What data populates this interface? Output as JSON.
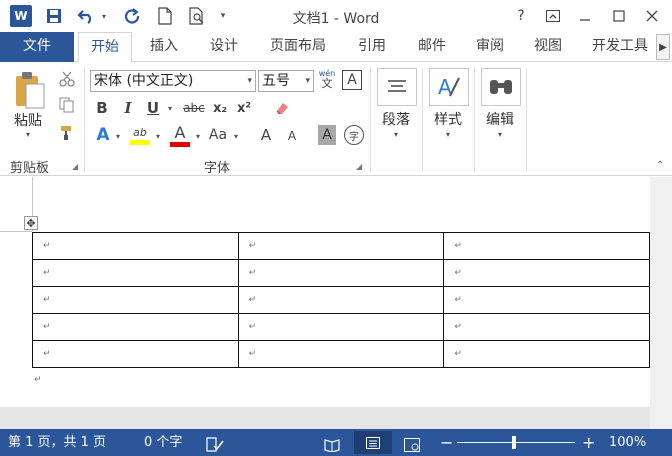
{
  "app": {
    "logo_letter": "W",
    "title": "文档1 - Word"
  },
  "quick_access": {
    "save_icon": "save-icon",
    "undo_icon": "undo-icon",
    "redo_icon": "repeat-icon",
    "new_icon": "new-document-icon",
    "preview_icon": "print-preview-icon",
    "customize_icon": "customize-quick-access-icon"
  },
  "window_controls": {
    "help": "?",
    "ribbon_options": "⊡",
    "minimize": "—",
    "maximize": "☐",
    "close": "✕"
  },
  "tabs": [
    {
      "label": "文件"
    },
    {
      "label": "开始"
    },
    {
      "label": "插入"
    },
    {
      "label": "设计"
    },
    {
      "label": "页面布局"
    },
    {
      "label": "引用"
    },
    {
      "label": "邮件"
    },
    {
      "label": "审阅"
    },
    {
      "label": "视图"
    },
    {
      "label": "开发工具"
    }
  ],
  "tab_scroll": "▶",
  "ribbon": {
    "clipboard": {
      "paste_label": "粘贴",
      "group_label": "剪贴板"
    },
    "font": {
      "font_name": "宋体 (中文正文)",
      "font_size": "五号",
      "phonetic": "wén",
      "phonetic_char": "文",
      "border_char": "A",
      "bold": "B",
      "italic": "I",
      "underline": "U",
      "strike": "abc",
      "subscript": "x₂",
      "superscript": "x²",
      "text_effect": "A",
      "highlight": "ab",
      "font_color": "A",
      "change_case": "Aa",
      "grow": "A",
      "shrink": "A",
      "shading": "A",
      "enclose": "字",
      "group_label": "字体"
    },
    "paragraph": {
      "label": "段落"
    },
    "styles": {
      "label": "样式"
    },
    "editing": {
      "label": "编辑"
    }
  },
  "document": {
    "table": {
      "rows": 5,
      "cols": 3,
      "cell_mark": "↵"
    },
    "para_mark": "↵",
    "move_handle": "✥"
  },
  "statusbar": {
    "page_info": "第 1 页，共 1 页",
    "word_count": "0 个字",
    "zoom_minus": "−",
    "zoom_plus": "+",
    "zoom_value": "100%",
    "zoom_level": 1.0
  },
  "colors": {
    "accent": "#2b579a",
    "highlight_yellow": "#ffff00",
    "font_red": "#e00000"
  }
}
